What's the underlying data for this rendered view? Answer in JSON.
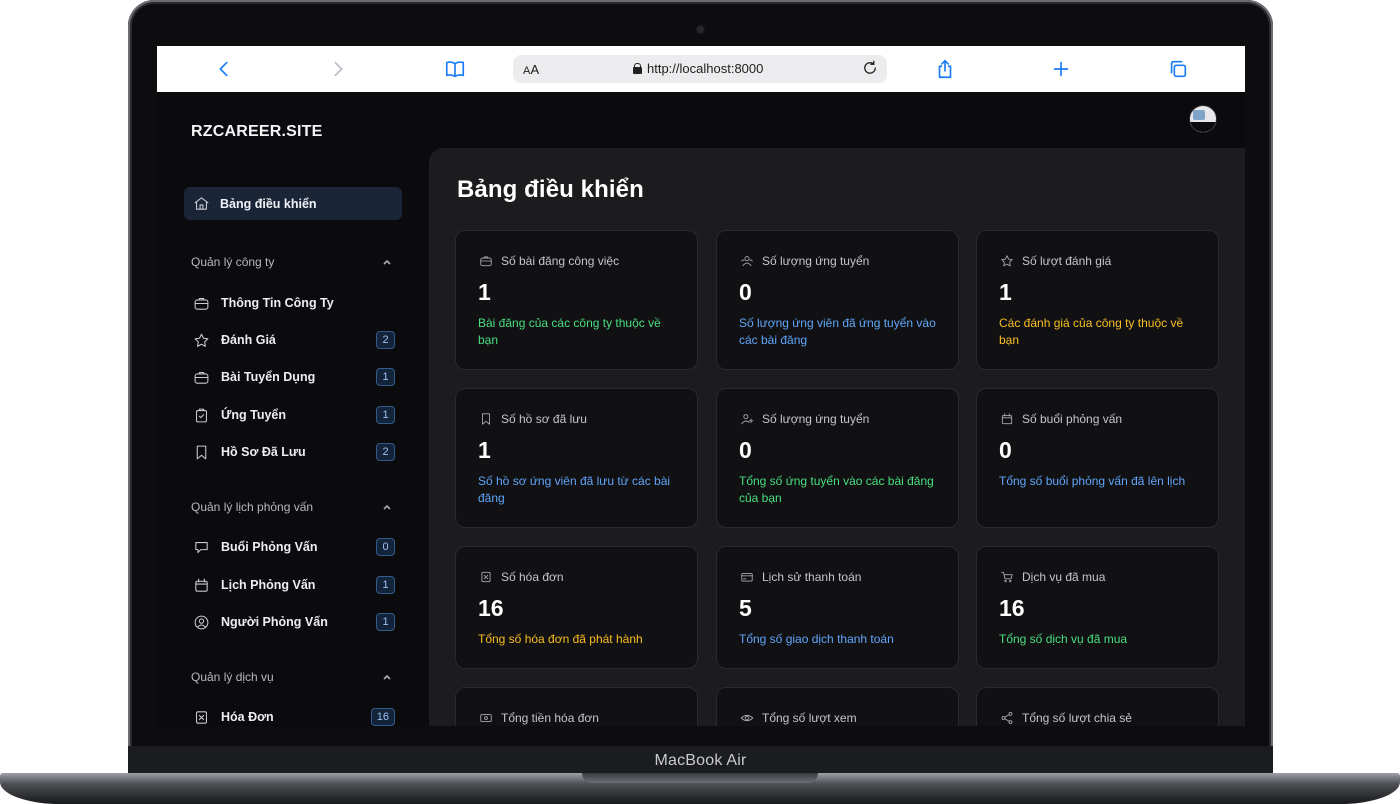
{
  "device": {
    "label": "MacBook Air"
  },
  "browser": {
    "text_size_label_small": "A",
    "text_size_label_big": "A",
    "url": "http://localhost:8000"
  },
  "app": {
    "brand": "RZCAREER.SITE",
    "page_title": "Bảng điều khiển",
    "nav_active": {
      "label": "Bảng điều khiển",
      "icon": "home-icon"
    },
    "sections": [
      {
        "title": "Quản lý công ty",
        "items": [
          {
            "label": "Thông Tin Công Ty",
            "icon": "briefcase-icon",
            "badge": ""
          },
          {
            "label": "Đánh Giá",
            "icon": "star-icon",
            "badge": "2"
          },
          {
            "label": "Bài Tuyển Dụng",
            "icon": "briefcase-icon",
            "badge": "1"
          },
          {
            "label": "Ứng Tuyển",
            "icon": "clipboard-check-icon",
            "badge": "1"
          },
          {
            "label": "Hồ Sơ Đã Lưu",
            "icon": "bookmark-icon",
            "badge": "2"
          }
        ]
      },
      {
        "title": "Quản lý lịch phỏng vấn",
        "items": [
          {
            "label": "Buổi Phỏng Vấn",
            "icon": "chat-icon",
            "badge": "0"
          },
          {
            "label": "Lịch Phỏng Vấn",
            "icon": "calendar-icon",
            "badge": "1"
          },
          {
            "label": "Người Phỏng Vấn",
            "icon": "user-circle-icon",
            "badge": "1"
          }
        ]
      },
      {
        "title": "Quản lý dịch vụ",
        "items": [
          {
            "label": "Hóa Đơn",
            "icon": "invoice-icon",
            "badge": "16"
          }
        ]
      }
    ],
    "cards": [
      {
        "title": "Số bài đăng công việc",
        "icon": "briefcase-icon",
        "value": "1",
        "desc": "Bài đăng của các công ty thuộc về bạn",
        "color": "#4ade80"
      },
      {
        "title": "Số lượng ứng tuyển",
        "icon": "users-icon",
        "value": "0",
        "desc": "Số lượng ứng viên đã ứng tuyển vào các bài đăng",
        "color": "#60a5fa"
      },
      {
        "title": "Số lượt đánh giá",
        "icon": "star-icon",
        "value": "1",
        "desc": "Các đánh giá của công ty thuộc về bạn",
        "color": "#fbbf24"
      },
      {
        "title": "Số hồ sơ đã lưu",
        "icon": "bookmark-icon",
        "value": "1",
        "desc": "Số hồ sơ ứng viên đã lưu từ các bài đăng",
        "color": "#60a5fa"
      },
      {
        "title": "Số lượng ứng tuyển",
        "icon": "user-plus-icon",
        "value": "0",
        "desc": "Tổng số ứng tuyển vào các bài đăng của bạn",
        "color": "#4ade80"
      },
      {
        "title": "Số buổi phỏng vấn",
        "icon": "calendar-icon",
        "value": "0",
        "desc": "Tổng số buổi phỏng vấn đã lên lịch",
        "color": "#60a5fa"
      },
      {
        "title": "Số hóa đơn",
        "icon": "invoice-icon",
        "value": "16",
        "desc": "Tổng số hóa đơn đã phát hành",
        "color": "#fbbf24"
      },
      {
        "title": "Lịch sử thanh toán",
        "icon": "credit-card-icon",
        "value": "5",
        "desc": "Tổng số giao dịch thanh toán",
        "color": "#60a5fa"
      },
      {
        "title": "Dịch vụ đã mua",
        "icon": "cart-icon",
        "value": "16",
        "desc": "Tổng số dịch vụ đã mua",
        "color": "#4ade80"
      },
      {
        "title": "Tổng tiền hóa đơn",
        "icon": "cash-icon",
        "value": "",
        "desc": "",
        "color": "#60a5fa"
      },
      {
        "title": "Tổng số lượt xem",
        "icon": "eye-icon",
        "value": "",
        "desc": "",
        "color": "#60a5fa"
      },
      {
        "title": "Tổng số lượt chia sẻ",
        "icon": "share-icon",
        "value": "",
        "desc": "",
        "color": "#60a5fa"
      }
    ]
  }
}
